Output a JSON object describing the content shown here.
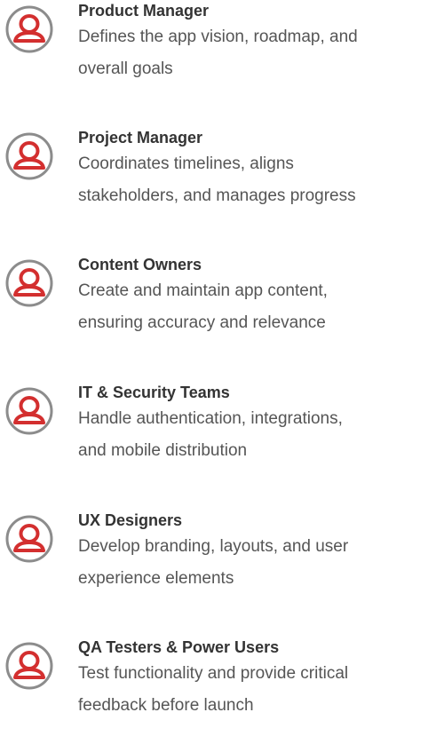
{
  "colors": {
    "icon_ring": "#8c8c8c",
    "icon_person": "#d32f2f",
    "title_text": "#333333",
    "desc_text": "#555555"
  },
  "roles": [
    {
      "icon": "person-icon",
      "title": "Product Manager",
      "desc_line1": "Defines the app vision, roadmap, and",
      "desc_line2": "overall goals"
    },
    {
      "icon": "person-icon",
      "title": "Project Manager",
      "desc_line1": "Coordinates timelines, aligns",
      "desc_line2": "stakeholders, and manages progress"
    },
    {
      "icon": "person-icon",
      "title": "Content Owners",
      "desc_line1": "Create and maintain app content,",
      "desc_line2": "ensuring accuracy and relevance"
    },
    {
      "icon": "person-icon",
      "title": "IT & Security Teams",
      "desc_line1": "Handle authentication, integrations,",
      "desc_line2": "and mobile distribution"
    },
    {
      "icon": "person-icon",
      "title": "UX Designers",
      "desc_line1": "Develop branding, layouts, and user",
      "desc_line2": "experience elements"
    },
    {
      "icon": "person-icon",
      "title": "QA Testers & Power Users",
      "desc_line1": "Test functionality and provide critical",
      "desc_line2": "feedback before launch"
    }
  ]
}
